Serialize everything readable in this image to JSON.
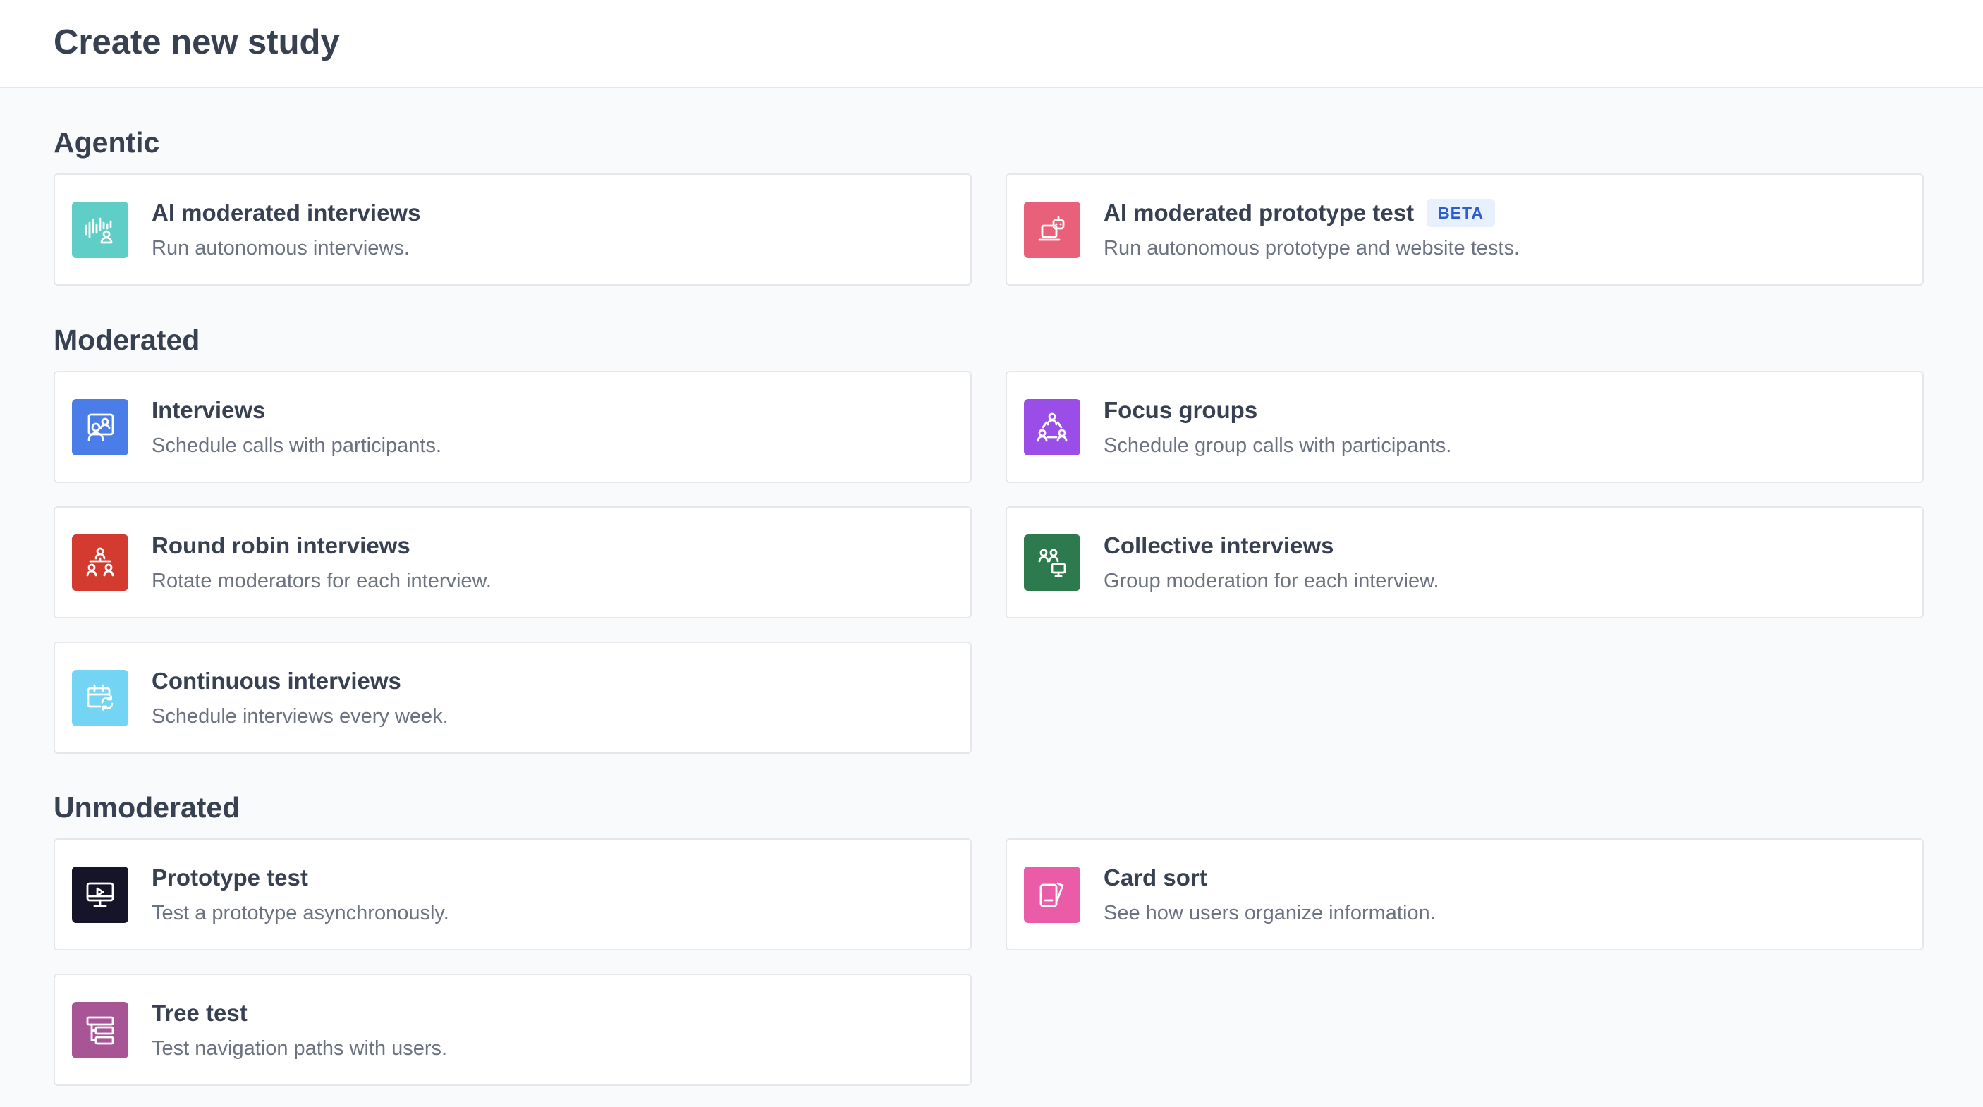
{
  "page": {
    "title": "Create new study"
  },
  "sections": [
    {
      "title": "Agentic",
      "cards": [
        {
          "title": "AI moderated interviews",
          "description": "Run autonomous interviews.",
          "icon": "voice-person-icon",
          "color": "#5ecec6"
        },
        {
          "title": "AI moderated prototype test",
          "badge": "BETA",
          "description": "Run autonomous prototype and website tests.",
          "icon": "robot-laptop-icon",
          "color": "#e8607a"
        }
      ]
    },
    {
      "title": "Moderated",
      "cards": [
        {
          "title": "Interviews",
          "description": "Schedule calls with participants.",
          "icon": "video-call-icon",
          "color": "#4a7de8"
        },
        {
          "title": "Focus groups",
          "description": "Schedule group calls with participants.",
          "icon": "group-triangle-icon",
          "color": "#9b4de8"
        },
        {
          "title": "Round robin interviews",
          "description": "Rotate moderators for each interview.",
          "icon": "hierarchy-people-icon",
          "color": "#d43b30"
        },
        {
          "title": "Collective interviews",
          "description": "Group moderation for each interview.",
          "icon": "people-monitor-icon",
          "color": "#2e7a4f"
        },
        {
          "title": "Continuous interviews",
          "description": "Schedule interviews every week.",
          "icon": "calendar-repeat-icon",
          "color": "#74d4f4"
        }
      ]
    },
    {
      "title": "Unmoderated",
      "cards": [
        {
          "title": "Prototype test",
          "description": "Test a prototype asynchronously.",
          "icon": "monitor-play-icon",
          "color": "#151429"
        },
        {
          "title": "Card sort",
          "description": "See how users organize information.",
          "icon": "cards-icon",
          "color": "#ea5ca8"
        },
        {
          "title": "Tree test",
          "description": "Test navigation paths with users.",
          "icon": "tree-list-icon",
          "color": "#a85596"
        }
      ]
    }
  ]
}
